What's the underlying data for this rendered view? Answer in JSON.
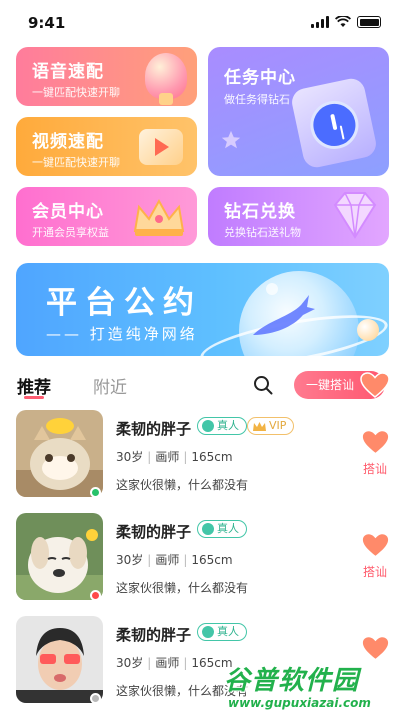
{
  "status_bar": {
    "time": "9:41"
  },
  "cards": {
    "voice": {
      "title": "语音速配",
      "subtitle": "一键匹配快速开聊"
    },
    "video": {
      "title": "视频速配",
      "subtitle": "一键匹配快速开聊"
    },
    "task": {
      "title": "任务中心",
      "subtitle": "做任务得钻石"
    },
    "vip": {
      "title": "会员中心",
      "subtitle": "开通会员享权益"
    },
    "diamond": {
      "title": "钻石兑换",
      "subtitle": "兑换钻石送礼物"
    }
  },
  "banner": {
    "title": "平台公约",
    "subtitle": "—— 打造纯净网络"
  },
  "tabs": [
    {
      "label": "推荐",
      "active": true
    },
    {
      "label": "附近",
      "active": false
    }
  ],
  "greet_button": {
    "label": "一键搭讪"
  },
  "users": [
    {
      "name": "柔韧的胖子",
      "badges": [
        "真人",
        "VIP"
      ],
      "age": "30岁",
      "job": "画师",
      "height": "165cm",
      "signature": "这家伙很懒，什么都没有",
      "action": "搭讪",
      "online_color": "#27c26a"
    },
    {
      "name": "柔韧的胖子",
      "badges": [
        "真人"
      ],
      "age": "30岁",
      "job": "画师",
      "height": "165cm",
      "signature": "这家伙很懒，什么都没有",
      "action": "搭讪",
      "online_color": "#ff4a4a"
    },
    {
      "name": "柔韧的胖子",
      "badges": [
        "真人"
      ],
      "age": "30岁",
      "job": "画师",
      "height": "165cm",
      "signature": "这家伙很懒，什么都没有",
      "action": "搭讪",
      "online_color": "#b9b9b9"
    }
  ],
  "watermark": {
    "title": "谷普软件园",
    "url": "www.gupuxiazai.com"
  },
  "colors": {
    "accent": "#ff5d72",
    "real_badge": "#43c6a8",
    "vip_badge": "#e3a93f"
  }
}
